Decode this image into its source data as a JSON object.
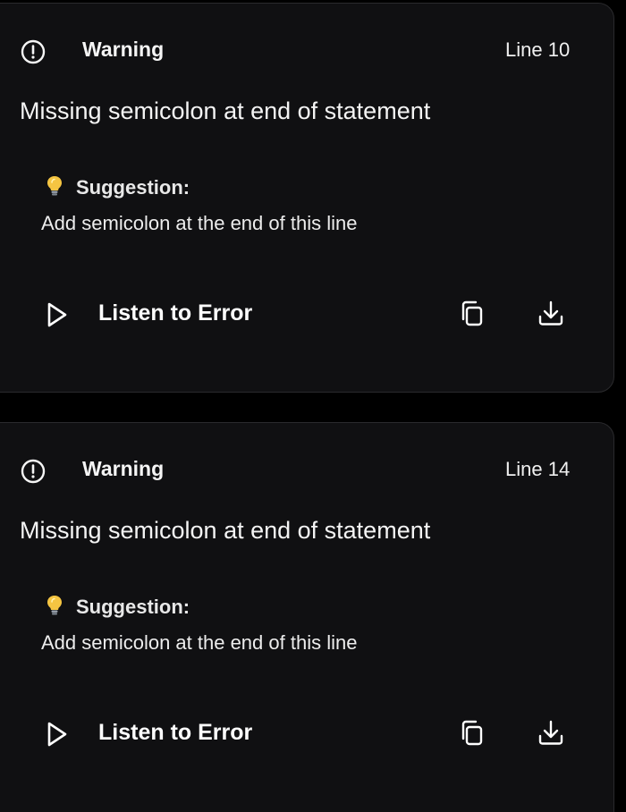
{
  "issues": [
    {
      "severity": "Warning",
      "line": "Line 10",
      "message": "Missing semicolon at end of statement",
      "suggestion_label": "Suggestion:",
      "suggestion": "Add semicolon at the end of this line",
      "listen_label": "Listen to Error"
    },
    {
      "severity": "Warning",
      "line": "Line 14",
      "message": "Missing semicolon at end of statement",
      "suggestion_label": "Suggestion:",
      "suggestion": "Add semicolon at the end of this line",
      "listen_label": "Listen to Error"
    }
  ],
  "icons": {
    "severity": "alert-circle-icon",
    "suggestion": "lightbulb-icon",
    "play": "play-icon",
    "copy": "copy-icon",
    "download": "download-icon"
  },
  "colors": {
    "background": "#000000",
    "card": "#101012",
    "border": "#2a2a2d",
    "text": "#f2f2f2",
    "bulb": "#f5c542"
  }
}
